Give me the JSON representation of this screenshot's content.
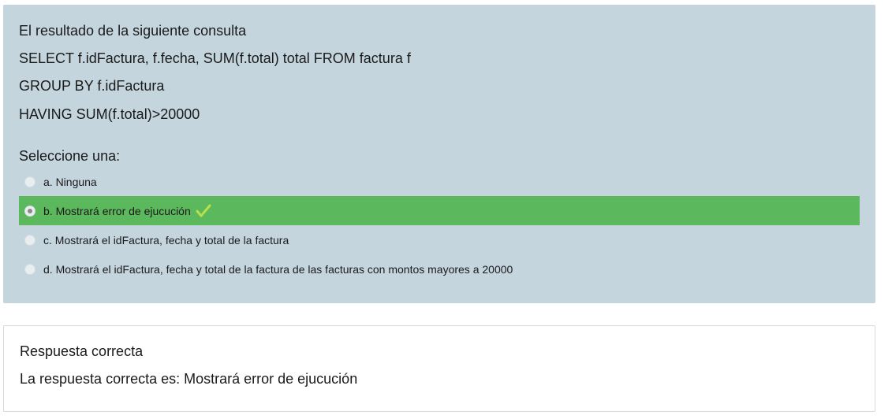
{
  "question": {
    "lines": [
      "El resultado de la siguiente consulta",
      "SELECT f.idFactura, f.fecha, SUM(f.total) total FROM factura f",
      "GROUP BY f.idFactura",
      "HAVING SUM(f.total)>20000"
    ],
    "prompt": "Seleccione una:",
    "options": [
      {
        "label": "a. Ninguna",
        "selected": false
      },
      {
        "label": "b. Mostrará error de ejucución",
        "selected": true
      },
      {
        "label": "c. Mostrará el idFactura, fecha y total de la factura",
        "selected": false
      },
      {
        "label": "d. Mostrará el idFactura, fecha y total de la factura de las facturas con montos mayores a 20000",
        "selected": false
      }
    ]
  },
  "feedback": {
    "status": "Respuesta correcta",
    "correct_answer": "La respuesta correcta es: Mostrará error de ejucución"
  },
  "colors": {
    "question_bg": "#c4d5de",
    "selected_bg": "#5cb85c",
    "check": "#b8e04a"
  },
  "icons": {
    "correct": "checkmark-icon"
  }
}
